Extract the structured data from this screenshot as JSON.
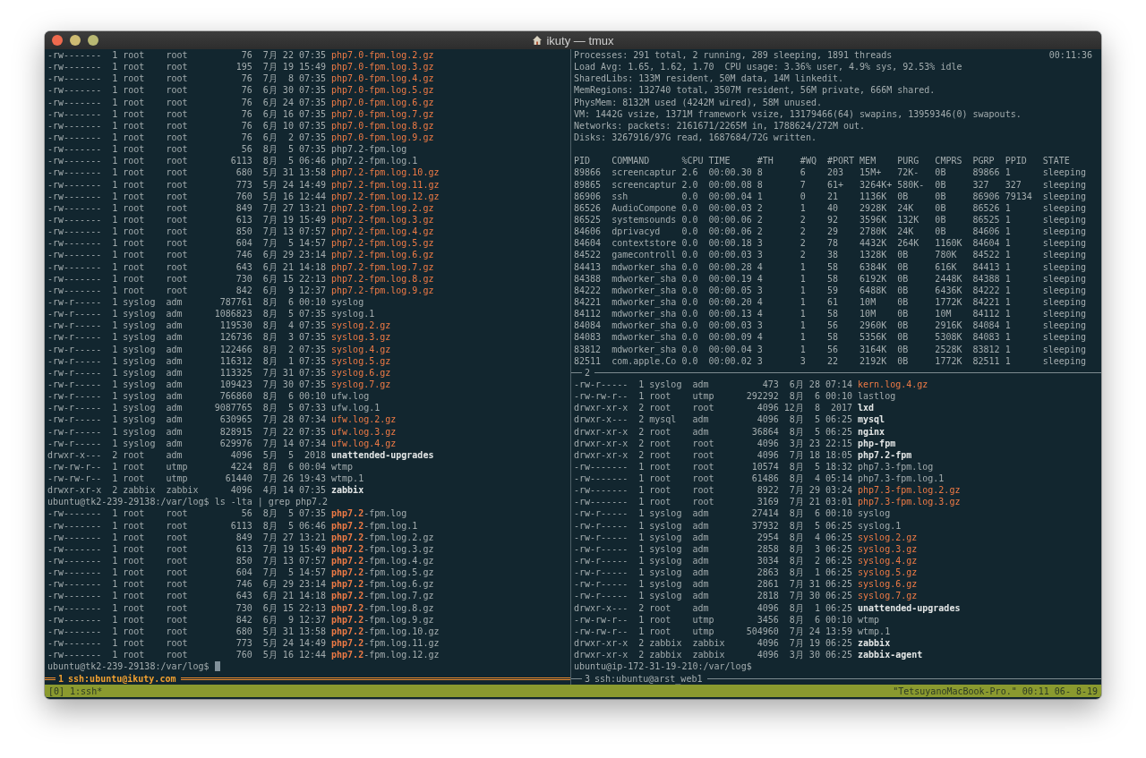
{
  "window": {
    "title": "ikuty — tmux"
  },
  "panes": [
    {
      "number": "1",
      "title": "ssh:ubuntu@ikuty.com",
      "active": true,
      "lines": [
        {
          "kind": "archive",
          "cols": [
            "-rw-------",
            "1",
            "root",
            "root",
            "76",
            "7月",
            "22",
            "07:35"
          ],
          "name": "php7.0-fpm.log.2.gz"
        },
        {
          "kind": "archive",
          "cols": [
            "-rw-------",
            "1",
            "root",
            "root",
            "195",
            "7月",
            "19",
            "15:49"
          ],
          "name": "php7.0-fpm.log.3.gz"
        },
        {
          "kind": "archive",
          "cols": [
            "-rw-------",
            "1",
            "root",
            "root",
            "76",
            "7月",
            "8",
            "07:35"
          ],
          "name": "php7.0-fpm.log.4.gz"
        },
        {
          "kind": "archive",
          "cols": [
            "-rw-------",
            "1",
            "root",
            "root",
            "76",
            "6月",
            "30",
            "07:35"
          ],
          "name": "php7.0-fpm.log.5.gz"
        },
        {
          "kind": "archive",
          "cols": [
            "-rw-------",
            "1",
            "root",
            "root",
            "76",
            "6月",
            "24",
            "07:35"
          ],
          "name": "php7.0-fpm.log.6.gz"
        },
        {
          "kind": "archive",
          "cols": [
            "-rw-------",
            "1",
            "root",
            "root",
            "76",
            "6月",
            "16",
            "07:35"
          ],
          "name": "php7.0-fpm.log.7.gz"
        },
        {
          "kind": "archive",
          "cols": [
            "-rw-------",
            "1",
            "root",
            "root",
            "76",
            "6月",
            "10",
            "07:35"
          ],
          "name": "php7.0-fpm.log.8.gz"
        },
        {
          "kind": "archive",
          "cols": [
            "-rw-------",
            "1",
            "root",
            "root",
            "76",
            "6月",
            "2",
            "07:35"
          ],
          "name": "php7.0-fpm.log.9.gz"
        },
        {
          "kind": "file",
          "cols": [
            "-rw-------",
            "1",
            "root",
            "root",
            "56",
            "8月",
            "5",
            "07:35"
          ],
          "name": "php7.2-fpm.log"
        },
        {
          "kind": "file",
          "cols": [
            "-rw-------",
            "1",
            "root",
            "root",
            "6113",
            "8月",
            "5",
            "06:46"
          ],
          "name": "php7.2-fpm.log.1"
        },
        {
          "kind": "archive",
          "cols": [
            "-rw-------",
            "1",
            "root",
            "root",
            "680",
            "5月",
            "31",
            "13:58"
          ],
          "name": "php7.2-fpm.log.10.gz"
        },
        {
          "kind": "archive",
          "cols": [
            "-rw-------",
            "1",
            "root",
            "root",
            "773",
            "5月",
            "24",
            "14:49"
          ],
          "name": "php7.2-fpm.log.11.gz"
        },
        {
          "kind": "archive",
          "cols": [
            "-rw-------",
            "1",
            "root",
            "root",
            "760",
            "5月",
            "16",
            "12:44"
          ],
          "name": "php7.2-fpm.log.12.gz"
        },
        {
          "kind": "archive",
          "cols": [
            "-rw-------",
            "1",
            "root",
            "root",
            "849",
            "7月",
            "27",
            "13:21"
          ],
          "name": "php7.2-fpm.log.2.gz"
        },
        {
          "kind": "archive",
          "cols": [
            "-rw-------",
            "1",
            "root",
            "root",
            "613",
            "7月",
            "19",
            "15:49"
          ],
          "name": "php7.2-fpm.log.3.gz"
        },
        {
          "kind": "archive",
          "cols": [
            "-rw-------",
            "1",
            "root",
            "root",
            "850",
            "7月",
            "13",
            "07:57"
          ],
          "name": "php7.2-fpm.log.4.gz"
        },
        {
          "kind": "archive",
          "cols": [
            "-rw-------",
            "1",
            "root",
            "root",
            "604",
            "7月",
            "5",
            "14:57"
          ],
          "name": "php7.2-fpm.log.5.gz"
        },
        {
          "kind": "archive",
          "cols": [
            "-rw-------",
            "1",
            "root",
            "root",
            "746",
            "6月",
            "29",
            "23:14"
          ],
          "name": "php7.2-fpm.log.6.gz"
        },
        {
          "kind": "archive",
          "cols": [
            "-rw-------",
            "1",
            "root",
            "root",
            "643",
            "6月",
            "21",
            "14:18"
          ],
          "name": "php7.2-fpm.log.7.gz"
        },
        {
          "kind": "archive",
          "cols": [
            "-rw-------",
            "1",
            "root",
            "root",
            "730",
            "6月",
            "15",
            "22:13"
          ],
          "name": "php7.2-fpm.log.8.gz"
        },
        {
          "kind": "archive",
          "cols": [
            "-rw-------",
            "1",
            "root",
            "root",
            "842",
            "6月",
            "9",
            "12:37"
          ],
          "name": "php7.2-fpm.log.9.gz"
        },
        {
          "kind": "file",
          "cols": [
            "-rw-r-----",
            "1",
            "syslog",
            "adm",
            "787761",
            "8月",
            "6",
            "00:10"
          ],
          "name": "syslog"
        },
        {
          "kind": "file",
          "cols": [
            "-rw-r-----",
            "1",
            "syslog",
            "adm",
            "1086823",
            "8月",
            "5",
            "07:35"
          ],
          "name": "syslog.1"
        },
        {
          "kind": "archive",
          "cols": [
            "-rw-r-----",
            "1",
            "syslog",
            "adm",
            "119530",
            "8月",
            "4",
            "07:35"
          ],
          "name": "syslog.2.gz"
        },
        {
          "kind": "archive",
          "cols": [
            "-rw-r-----",
            "1",
            "syslog",
            "adm",
            "126736",
            "8月",
            "3",
            "07:35"
          ],
          "name": "syslog.3.gz"
        },
        {
          "kind": "archive",
          "cols": [
            "-rw-r-----",
            "1",
            "syslog",
            "adm",
            "122466",
            "8月",
            "2",
            "07:35"
          ],
          "name": "syslog.4.gz"
        },
        {
          "kind": "archive",
          "cols": [
            "-rw-r-----",
            "1",
            "syslog",
            "adm",
            "116312",
            "8月",
            "1",
            "07:35"
          ],
          "name": "syslog.5.gz"
        },
        {
          "kind": "archive",
          "cols": [
            "-rw-r-----",
            "1",
            "syslog",
            "adm",
            "113325",
            "7月",
            "31",
            "07:35"
          ],
          "name": "syslog.6.gz"
        },
        {
          "kind": "archive",
          "cols": [
            "-rw-r-----",
            "1",
            "syslog",
            "adm",
            "109423",
            "7月",
            "30",
            "07:35"
          ],
          "name": "syslog.7.gz"
        },
        {
          "kind": "file",
          "cols": [
            "-rw-r-----",
            "1",
            "syslog",
            "adm",
            "766860",
            "8月",
            "6",
            "00:10"
          ],
          "name": "ufw.log"
        },
        {
          "kind": "file",
          "cols": [
            "-rw-r-----",
            "1",
            "syslog",
            "adm",
            "9087765",
            "8月",
            "5",
            "07:33"
          ],
          "name": "ufw.log.1"
        },
        {
          "kind": "archive",
          "cols": [
            "-rw-r-----",
            "1",
            "syslog",
            "adm",
            "630965",
            "7月",
            "28",
            "07:34"
          ],
          "name": "ufw.log.2.gz"
        },
        {
          "kind": "archive",
          "cols": [
            "-rw-r-----",
            "1",
            "syslog",
            "adm",
            "828915",
            "7月",
            "22",
            "07:35"
          ],
          "name": "ufw.log.3.gz"
        },
        {
          "kind": "archive",
          "cols": [
            "-rw-r-----",
            "1",
            "syslog",
            "adm",
            "629976",
            "7月",
            "14",
            "07:34"
          ],
          "name": "ufw.log.4.gz"
        },
        {
          "kind": "directory",
          "cols": [
            "drwxr-x---",
            "2",
            "root",
            "adm",
            "4096",
            "5月",
            "5",
            "2018"
          ],
          "name": "unattended-upgrades"
        },
        {
          "kind": "file",
          "cols": [
            "-rw-rw-r--",
            "1",
            "root",
            "utmp",
            "4224",
            "8月",
            "6",
            "00:04"
          ],
          "name": "wtmp"
        },
        {
          "kind": "file",
          "cols": [
            "-rw-rw-r--",
            "1",
            "root",
            "utmp",
            "61440",
            "7月",
            "26",
            "19:43"
          ],
          "name": "wtmp.1"
        },
        {
          "kind": "directory",
          "cols": [
            "drwxr-xr-x",
            "2",
            "zabbix",
            "zabbix",
            "4096",
            "4月",
            "14",
            "07:35"
          ],
          "name": "zabbix"
        },
        {
          "kind": "prompt",
          "prompt": "ubuntu@tk2-239-29138:/var/log$",
          "command": "ls -lta | grep php7.2",
          "cursor": false
        },
        {
          "kind": "match",
          "cols": [
            "-rw-------",
            "1",
            "root",
            "root",
            "56",
            "8月",
            "5",
            "07:35"
          ],
          "match": "php7.2",
          "name": "-fpm.log"
        },
        {
          "kind": "match",
          "cols": [
            "-rw-------",
            "1",
            "root",
            "root",
            "6113",
            "8月",
            "5",
            "06:46"
          ],
          "match": "php7.2",
          "name": "-fpm.log.1"
        },
        {
          "kind": "match",
          "cols": [
            "-rw-------",
            "1",
            "root",
            "root",
            "849",
            "7月",
            "27",
            "13:21"
          ],
          "match": "php7.2",
          "name": "-fpm.log.2.gz"
        },
        {
          "kind": "match",
          "cols": [
            "-rw-------",
            "1",
            "root",
            "root",
            "613",
            "7月",
            "19",
            "15:49"
          ],
          "match": "php7.2",
          "name": "-fpm.log.3.gz"
        },
        {
          "kind": "match",
          "cols": [
            "-rw-------",
            "1",
            "root",
            "root",
            "850",
            "7月",
            "13",
            "07:57"
          ],
          "match": "php7.2",
          "name": "-fpm.log.4.gz"
        },
        {
          "kind": "match",
          "cols": [
            "-rw-------",
            "1",
            "root",
            "root",
            "604",
            "7月",
            "5",
            "14:57"
          ],
          "match": "php7.2",
          "name": "-fpm.log.5.gz"
        },
        {
          "kind": "match",
          "cols": [
            "-rw-------",
            "1",
            "root",
            "root",
            "746",
            "6月",
            "29",
            "23:14"
          ],
          "match": "php7.2",
          "name": "-fpm.log.6.gz"
        },
        {
          "kind": "match",
          "cols": [
            "-rw-------",
            "1",
            "root",
            "root",
            "643",
            "6月",
            "21",
            "14:18"
          ],
          "match": "php7.2",
          "name": "-fpm.log.7.gz"
        },
        {
          "kind": "match",
          "cols": [
            "-rw-------",
            "1",
            "root",
            "root",
            "730",
            "6月",
            "15",
            "22:13"
          ],
          "match": "php7.2",
          "name": "-fpm.log.8.gz"
        },
        {
          "kind": "match",
          "cols": [
            "-rw-------",
            "1",
            "root",
            "root",
            "842",
            "6月",
            "9",
            "12:37"
          ],
          "match": "php7.2",
          "name": "-fpm.log.9.gz"
        },
        {
          "kind": "match",
          "cols": [
            "-rw-------",
            "1",
            "root",
            "root",
            "680",
            "5月",
            "31",
            "13:58"
          ],
          "match": "php7.2",
          "name": "-fpm.log.10.gz"
        },
        {
          "kind": "match",
          "cols": [
            "-rw-------",
            "1",
            "root",
            "root",
            "773",
            "5月",
            "24",
            "14:49"
          ],
          "match": "php7.2",
          "name": "-fpm.log.11.gz"
        },
        {
          "kind": "match",
          "cols": [
            "-rw-------",
            "1",
            "root",
            "root",
            "760",
            "5月",
            "16",
            "12:44"
          ],
          "match": "php7.2",
          "name": "-fpm.log.12.gz"
        },
        {
          "kind": "prompt",
          "prompt": "ubuntu@tk2-239-29138:/var/log$",
          "cursor": true
        }
      ]
    },
    {
      "number": "2",
      "active": false,
      "lines": [
        {
          "kind": "stat",
          "text": "Processes: 291 total, 2 running, 289 sleeping, 1891 threads",
          "right": "00:11:36"
        },
        {
          "kind": "stat",
          "text": "Load Avg: 1.65, 1.62, 1.70  CPU usage: 3.36% user, 4.9% sys, 92.53% idle"
        },
        {
          "kind": "stat",
          "text": "SharedLibs: 133M resident, 50M data, 14M linkedit."
        },
        {
          "kind": "stat",
          "text": "MemRegions: 132740 total, 3507M resident, 56M private, 666M shared."
        },
        {
          "kind": "stat",
          "text": "PhysMem: 8132M used (4242M wired), 58M unused."
        },
        {
          "kind": "stat",
          "text": "VM: 1442G vsize, 1371M framework vsize, 13179466(64) swapins, 13959346(0) swapouts."
        },
        {
          "kind": "stat",
          "text": "Networks: packets: 2161671/2265M in, 1788624/272M out."
        },
        {
          "kind": "stat",
          "text": "Disks: 3267916/97G read, 1687684/72G written."
        },
        {
          "kind": "blank"
        },
        {
          "kind": "header",
          "cols": [
            "PID",
            "COMMAND",
            "%CPU",
            "TIME",
            "#TH",
            "#WQ",
            "#PORT",
            "MEM",
            "PURG",
            "CMPRS",
            "PGRP",
            "PPID",
            "STATE"
          ]
        },
        {
          "kind": "process",
          "cols": [
            "89866",
            "screencaptur",
            "2.6",
            "00:00.30",
            "8",
            "6",
            "203",
            "15M+",
            "72K-",
            "0B",
            "89866",
            "1",
            "sleeping"
          ]
        },
        {
          "kind": "process",
          "cols": [
            "89865",
            "screencaptur",
            "2.0",
            "00:00.08",
            "8",
            "7",
            "61+",
            "3264K+",
            "580K-",
            "0B",
            "327",
            "327",
            "sleeping"
          ]
        },
        {
          "kind": "process",
          "cols": [
            "86906",
            "ssh",
            "0.0",
            "00:00.04",
            "1",
            "0",
            "21",
            "1136K",
            "0B",
            "0B",
            "86906",
            "79134",
            "sleeping"
          ]
        },
        {
          "kind": "process",
          "cols": [
            "86526",
            "AudioCompone",
            "0.0",
            "00:00.03",
            "2",
            "1",
            "40",
            "2928K",
            "24K",
            "0B",
            "86526",
            "1",
            "sleeping"
          ]
        },
        {
          "kind": "process",
          "cols": [
            "86525",
            "systemsounds",
            "0.0",
            "00:00.06",
            "2",
            "2",
            "92",
            "3596K",
            "132K",
            "0B",
            "86525",
            "1",
            "sleeping"
          ]
        },
        {
          "kind": "process",
          "cols": [
            "84606",
            "dprivacyd",
            "0.0",
            "00:00.06",
            "2",
            "2",
            "29",
            "2780K",
            "24K",
            "0B",
            "84606",
            "1",
            "sleeping"
          ]
        },
        {
          "kind": "process",
          "cols": [
            "84604",
            "contextstore",
            "0.0",
            "00:00.18",
            "3",
            "2",
            "78",
            "4432K",
            "264K",
            "1160K",
            "84604",
            "1",
            "sleeping"
          ]
        },
        {
          "kind": "process",
          "cols": [
            "84522",
            "gamecontroll",
            "0.0",
            "00:00.03",
            "3",
            "2",
            "38",
            "1328K",
            "0B",
            "780K",
            "84522",
            "1",
            "sleeping"
          ]
        },
        {
          "kind": "process",
          "cols": [
            "84413",
            "mdworker_sha",
            "0.0",
            "00:00.28",
            "4",
            "1",
            "58",
            "6384K",
            "0B",
            "616K",
            "84413",
            "1",
            "sleeping"
          ]
        },
        {
          "kind": "process",
          "cols": [
            "84388",
            "mdworker_sha",
            "0.0",
            "00:00.19",
            "4",
            "1",
            "58",
            "6192K",
            "0B",
            "2448K",
            "84388",
            "1",
            "sleeping"
          ]
        },
        {
          "kind": "process",
          "cols": [
            "84222",
            "mdworker_sha",
            "0.0",
            "00:00.05",
            "3",
            "1",
            "59",
            "6488K",
            "0B",
            "6436K",
            "84222",
            "1",
            "sleeping"
          ]
        },
        {
          "kind": "process",
          "cols": [
            "84221",
            "mdworker_sha",
            "0.0",
            "00:00.20",
            "4",
            "1",
            "61",
            "10M",
            "0B",
            "1772K",
            "84221",
            "1",
            "sleeping"
          ]
        },
        {
          "kind": "process",
          "cols": [
            "84112",
            "mdworker_sha",
            "0.0",
            "00:00.13",
            "4",
            "1",
            "58",
            "10M",
            "0B",
            "10M",
            "84112",
            "1",
            "sleeping"
          ]
        },
        {
          "kind": "process",
          "cols": [
            "84084",
            "mdworker_sha",
            "0.0",
            "00:00.03",
            "3",
            "1",
            "56",
            "2960K",
            "0B",
            "2916K",
            "84084",
            "1",
            "sleeping"
          ]
        },
        {
          "kind": "process",
          "cols": [
            "84083",
            "mdworker_sha",
            "0.0",
            "00:00.09",
            "4",
            "1",
            "58",
            "5356K",
            "0B",
            "5308K",
            "84083",
            "1",
            "sleeping"
          ]
        },
        {
          "kind": "process",
          "cols": [
            "83812",
            "mdworker_sha",
            "0.0",
            "00:00.04",
            "3",
            "1",
            "56",
            "3164K",
            "0B",
            "2528K",
            "83812",
            "1",
            "sleeping"
          ]
        },
        {
          "kind": "process",
          "cols": [
            "82511",
            "com.apple.Co",
            "0.0",
            "00:00.02",
            "3",
            "3",
            "22",
            "2192K",
            "0B",
            "1772K",
            "82511",
            "1",
            "sleeping"
          ]
        }
      ]
    },
    {
      "number": "3",
      "title": "ssh:ubuntu@arst_web1",
      "active": false,
      "lines": [
        {
          "kind": "archive",
          "cols": [
            "-rw-r-----",
            "1",
            "syslog",
            "adm",
            "473",
            "6月",
            "28",
            "07:14"
          ],
          "name": "kern.log.4.gz"
        },
        {
          "kind": "file",
          "cols": [
            "-rw-rw-r--",
            "1",
            "root",
            "utmp",
            "292292",
            "8月",
            "6",
            "00:10"
          ],
          "name": "lastlog"
        },
        {
          "kind": "directory",
          "cols": [
            "drwxr-xr-x",
            "2",
            "root",
            "root",
            "4096",
            "12月",
            "8",
            "2017"
          ],
          "name": "lxd"
        },
        {
          "kind": "directory",
          "cols": [
            "drwxr-x---",
            "2",
            "mysql",
            "adm",
            "4096",
            "8月",
            "5",
            "06:25"
          ],
          "name": "mysql"
        },
        {
          "kind": "directory",
          "cols": [
            "drwxr-xr-x",
            "2",
            "root",
            "adm",
            "36864",
            "8月",
            "5",
            "06:25"
          ],
          "name": "nginx"
        },
        {
          "kind": "directory",
          "cols": [
            "drwxr-xr-x",
            "2",
            "root",
            "root",
            "4096",
            "3月",
            "23",
            "22:15"
          ],
          "name": "php-fpm"
        },
        {
          "kind": "directory",
          "cols": [
            "drwxr-xr-x",
            "2",
            "root",
            "root",
            "4096",
            "7月",
            "18",
            "18:05"
          ],
          "name": "php7.2-fpm"
        },
        {
          "kind": "file",
          "cols": [
            "-rw-------",
            "1",
            "root",
            "root",
            "10574",
            "8月",
            "5",
            "18:32"
          ],
          "name": "php7.3-fpm.log"
        },
        {
          "kind": "file",
          "cols": [
            "-rw-------",
            "1",
            "root",
            "root",
            "61486",
            "8月",
            "4",
            "05:14"
          ],
          "name": "php7.3-fpm.log.1"
        },
        {
          "kind": "archive",
          "cols": [
            "-rw-------",
            "1",
            "root",
            "root",
            "8922",
            "7月",
            "29",
            "03:24"
          ],
          "name": "php7.3-fpm.log.2.gz"
        },
        {
          "kind": "archive",
          "cols": [
            "-rw-------",
            "1",
            "root",
            "root",
            "3169",
            "7月",
            "21",
            "03:01"
          ],
          "name": "php7.3-fpm.log.3.gz"
        },
        {
          "kind": "file",
          "cols": [
            "-rw-r-----",
            "1",
            "syslog",
            "adm",
            "27414",
            "8月",
            "6",
            "00:10"
          ],
          "name": "syslog"
        },
        {
          "kind": "file",
          "cols": [
            "-rw-r-----",
            "1",
            "syslog",
            "adm",
            "37932",
            "8月",
            "5",
            "06:25"
          ],
          "name": "syslog.1"
        },
        {
          "kind": "archive",
          "cols": [
            "-rw-r-----",
            "1",
            "syslog",
            "adm",
            "2954",
            "8月",
            "4",
            "06:25"
          ],
          "name": "syslog.2.gz"
        },
        {
          "kind": "archive",
          "cols": [
            "-rw-r-----",
            "1",
            "syslog",
            "adm",
            "2858",
            "8月",
            "3",
            "06:25"
          ],
          "name": "syslog.3.gz"
        },
        {
          "kind": "archive",
          "cols": [
            "-rw-r-----",
            "1",
            "syslog",
            "adm",
            "3034",
            "8月",
            "2",
            "06:25"
          ],
          "name": "syslog.4.gz"
        },
        {
          "kind": "archive",
          "cols": [
            "-rw-r-----",
            "1",
            "syslog",
            "adm",
            "2863",
            "8月",
            "1",
            "06:25"
          ],
          "name": "syslog.5.gz"
        },
        {
          "kind": "archive",
          "cols": [
            "-rw-r-----",
            "1",
            "syslog",
            "adm",
            "2861",
            "7月",
            "31",
            "06:25"
          ],
          "name": "syslog.6.gz"
        },
        {
          "kind": "archive",
          "cols": [
            "-rw-r-----",
            "1",
            "syslog",
            "adm",
            "2818",
            "7月",
            "30",
            "06:25"
          ],
          "name": "syslog.7.gz"
        },
        {
          "kind": "directory",
          "cols": [
            "drwxr-x---",
            "2",
            "root",
            "adm",
            "4096",
            "8月",
            "1",
            "06:25"
          ],
          "name": "unattended-upgrades"
        },
        {
          "kind": "file",
          "cols": [
            "-rw-rw-r--",
            "1",
            "root",
            "utmp",
            "3456",
            "8月",
            "6",
            "00:10"
          ],
          "name": "wtmp"
        },
        {
          "kind": "file",
          "cols": [
            "-rw-rw-r--",
            "1",
            "root",
            "utmp",
            "504960",
            "7月",
            "24",
            "13:59"
          ],
          "name": "wtmp.1"
        },
        {
          "kind": "directory",
          "cols": [
            "drwxr-xr-x",
            "2",
            "zabbix",
            "zabbix",
            "4096",
            "7月",
            "19",
            "06:25"
          ],
          "name": "zabbix"
        },
        {
          "kind": "directory",
          "cols": [
            "drwxr-xr-x",
            "2",
            "zabbix",
            "zabbix",
            "4096",
            "3月",
            "30",
            "06:25"
          ],
          "name": "zabbix-agent"
        },
        {
          "kind": "prompt",
          "prompt": "ubuntu@ip-172-31-19-210:/var/log$",
          "cursor": false
        }
      ]
    }
  ],
  "status_bar": {
    "session": "[0]",
    "window": "1:ssh*",
    "right": "\"TetsuyanoMacBook-Pro.\" 00:11 06- 8-19"
  }
}
